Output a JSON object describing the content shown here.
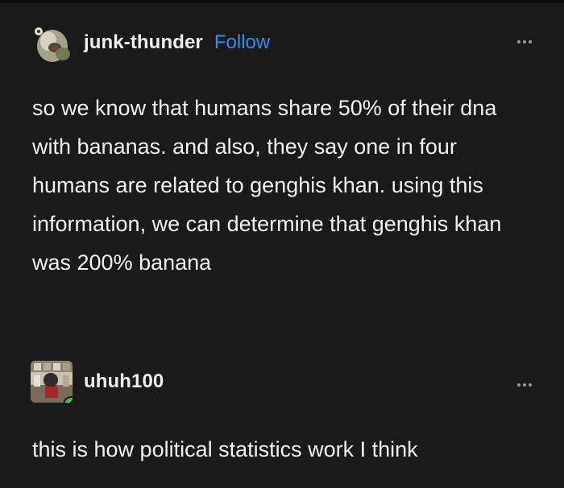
{
  "colors": {
    "background": "#1a1a1a",
    "text": "#f2f2f2",
    "follow": "#2b8ff5",
    "more_dots": "#9a9a9a",
    "reblog_badge": "#3bbf52"
  },
  "posts": [
    {
      "username": "junk-thunder",
      "follow_label": "Follow",
      "avatar_icon": "blob-creature-avatar",
      "more_icon": "more-dots-icon",
      "text": "so we know that humans share 50% of their dna with bananas. and also, they say one in four humans are related to genghis khan. using this information, we can determine that genghis khan was 200% banana"
    },
    {
      "username": "uhuh100",
      "avatar_icon": "room-avatar",
      "badge_icon": "reblog-icon",
      "more_icon": "more-dots-icon",
      "text": "this is how political statistics work I think"
    }
  ]
}
